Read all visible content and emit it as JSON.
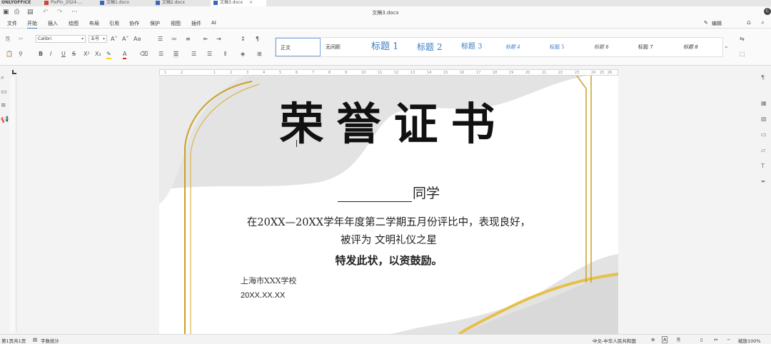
{
  "app": {
    "brand": "ONLYOFFICE",
    "doc_title": "文稿3.docx"
  },
  "tabs": [
    {
      "label": "PixPin_2024-...",
      "type": "pdf"
    },
    {
      "label": "文稿1.docx",
      "type": "doc"
    },
    {
      "label": "文稿2.docx",
      "type": "doc"
    },
    {
      "label": "文稿3.docx",
      "type": "doc",
      "active": true
    }
  ],
  "menu": {
    "items": [
      "文件",
      "开始",
      "插入",
      "绘图",
      "布局",
      "引用",
      "协作",
      "保护",
      "视图",
      "插件",
      "AI"
    ],
    "active": "开始",
    "edit_mode": "编辑"
  },
  "ribbon": {
    "font_name": "Calibri",
    "font_size": "五号",
    "styles": [
      {
        "label": "正文",
        "kind": "normal",
        "selected": true
      },
      {
        "label": "无间距",
        "kind": "normal"
      },
      {
        "label": "标题 1",
        "kind": "h1"
      },
      {
        "label": "标题 2",
        "kind": "h2"
      },
      {
        "label": "标题 3",
        "kind": "h3"
      },
      {
        "label": "标题 4",
        "kind": "h4"
      },
      {
        "label": "标题 5",
        "kind": "h5"
      },
      {
        "label": "标题 6",
        "kind": "h6"
      },
      {
        "label": "标题 7",
        "kind": "h7"
      },
      {
        "label": "标题 8",
        "kind": "h8"
      }
    ]
  },
  "ruler": {
    "ticks": [
      "1",
      "2",
      "1",
      "2",
      "3",
      "4",
      "5",
      "6",
      "7",
      "8",
      "9",
      "10",
      "11",
      "12",
      "13",
      "14",
      "15",
      "16",
      "17",
      "18",
      "19",
      "20",
      "21",
      "22",
      "23",
      "24",
      "25",
      "26"
    ]
  },
  "certificate": {
    "title": "荣誉证书",
    "recipient_suffix": "同学",
    "line1": "在20XX—20XX学年年度第二学期五月份评比中，表现良好，",
    "line2": "被评为  文明礼仪之星",
    "line3": "特发此状，以资鼓励。",
    "school": "上海市XXX学校",
    "date": "20XX.XX.XX"
  },
  "status": {
    "page_info": "第1页共1页",
    "word_count": "字数统计",
    "language": "中文-中华人民共和国",
    "zoom": "缩放100%"
  },
  "colors": {
    "gold": "#c9a227",
    "gray_shape": "#e3e3e3",
    "accent": "#3c7bd4"
  }
}
